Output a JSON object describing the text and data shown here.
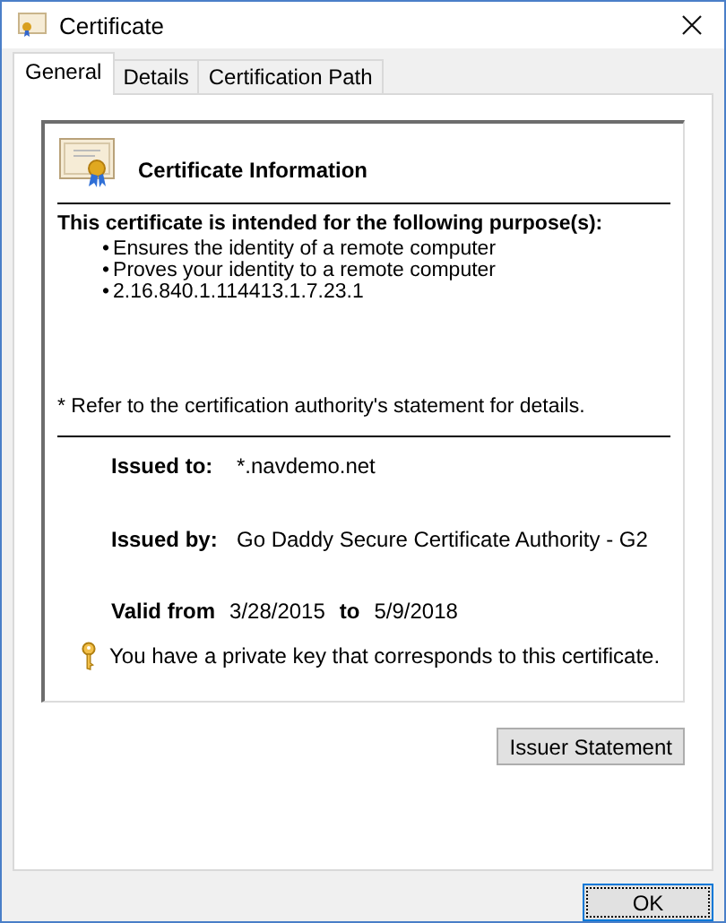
{
  "window": {
    "title": "Certificate"
  },
  "tabs": [
    {
      "label": "General",
      "selected": true
    },
    {
      "label": "Details",
      "selected": false
    },
    {
      "label": "Certification Path",
      "selected": false
    }
  ],
  "info": {
    "heading": "Certificate Information",
    "purpose_heading": "This certificate is intended for the following purpose(s):",
    "purposes": [
      "Ensures the identity of a remote computer",
      "Proves your identity to a remote computer",
      "2.16.840.1.114413.1.7.23.1"
    ],
    "bullet": "•",
    "note": "* Refer to the certification authority's statement for details.",
    "issued_to": {
      "label": "Issued to:",
      "value": "*.navdemo.net"
    },
    "issued_by": {
      "label": "Issued by:",
      "value": "Go Daddy Secure Certificate Authority - G2"
    },
    "valid": {
      "from_label": "Valid from",
      "from": "3/28/2015",
      "to_label": "to",
      "to": "5/9/2018"
    },
    "private_key": "You have a private key that corresponds to this certificate."
  },
  "buttons": {
    "issuer_statement": "Issuer Statement",
    "ok": "OK"
  }
}
